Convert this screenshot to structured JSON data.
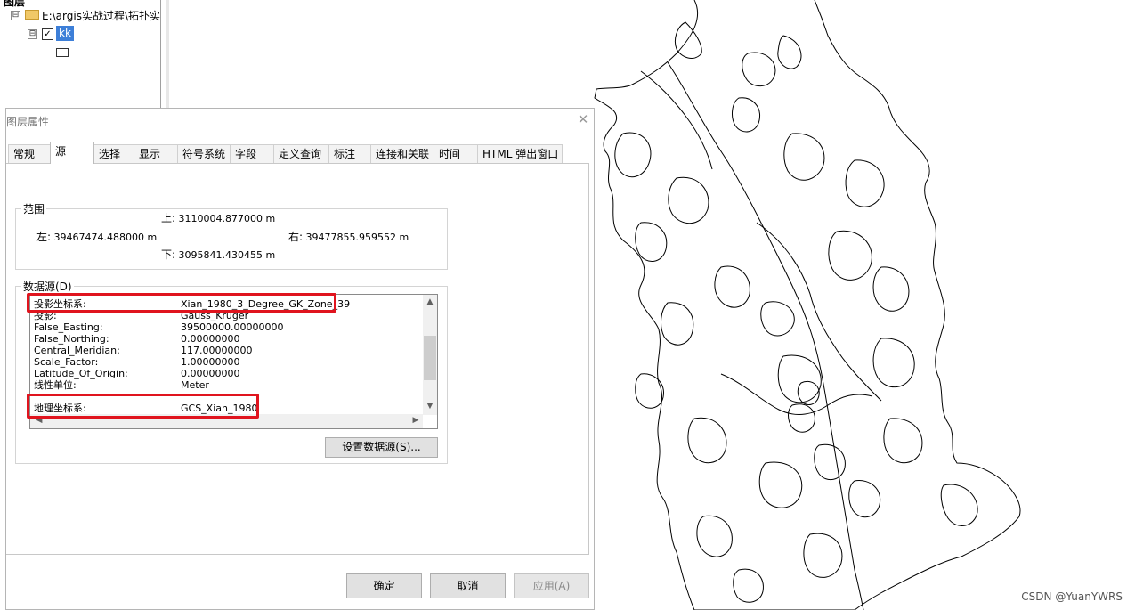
{
  "toc": {
    "root_label": "图层",
    "folder_path": "E:\\argis实战过程\\拓扑实",
    "layer_name": "kk",
    "expand_glyph": "⊟",
    "check_glyph": "✓"
  },
  "dialog": {
    "title": "图层属性",
    "close_glyph": "✕",
    "tabs": [
      "常规",
      "源",
      "选择",
      "显示",
      "符号系统",
      "字段",
      "定义查询",
      "标注",
      "连接和关联",
      "时间",
      "HTML 弹出窗口"
    ],
    "active_tab": "源",
    "extent": {
      "legend": "范围",
      "top_label": "上:",
      "top_value": "3110004.877000 m",
      "left_label": "左:",
      "left_value": "39467474.488000 m",
      "right_label": "右:",
      "right_value": "39477855.959552 m",
      "bottom_label": "下:",
      "bottom_value": "3095841.430455 m"
    },
    "source": {
      "legend": "数据源(D)",
      "rows": [
        {
          "key": "投影坐标系:",
          "value": "Xian_1980_3_Degree_GK_Zone_39"
        },
        {
          "key": "投影:",
          "value": "Gauss_Kruger"
        },
        {
          "key": "False_Easting:",
          "value": "39500000.00000000"
        },
        {
          "key": "False_Northing:",
          "value": "0.00000000"
        },
        {
          "key": "Central_Meridian:",
          "value": "117.00000000"
        },
        {
          "key": "Scale_Factor:",
          "value": "1.00000000"
        },
        {
          "key": "Latitude_Of_Origin:",
          "value": "0.00000000"
        },
        {
          "key": "线性单位:",
          "value": "Meter"
        },
        {
          "key": "",
          "value": ""
        },
        {
          "key": "地理坐标系:",
          "value": "GCS_Xian_1980"
        }
      ],
      "set_source_label": "设置数据源(S)..."
    },
    "buttons": {
      "ok": "确定",
      "cancel": "取消",
      "apply": "应用(A)"
    }
  },
  "watermark": "CSDN @YuanYWRS",
  "colors": {
    "highlight": "#e0141e",
    "selection": "#3d7fd8",
    "map_line": "#000000"
  }
}
